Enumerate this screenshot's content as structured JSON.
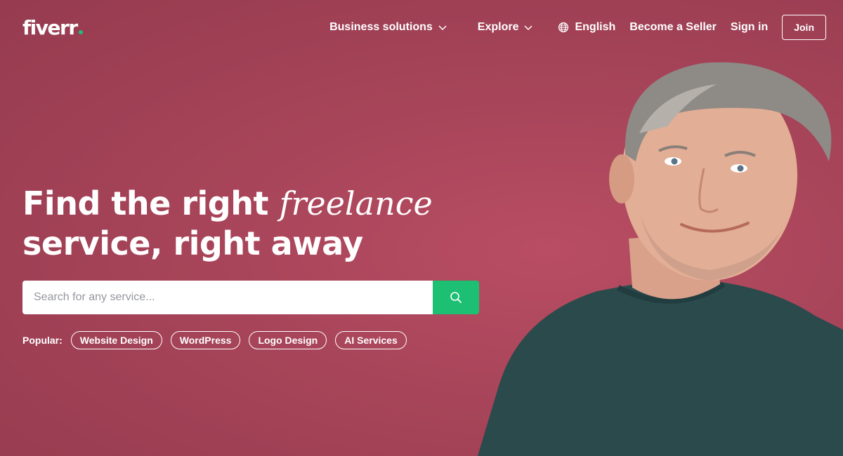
{
  "brand": {
    "name": "fiverr",
    "dot_color": "#1dbf73"
  },
  "nav": {
    "business_solutions": "Business solutions",
    "explore": "Explore",
    "language": "English",
    "become_seller": "Become a Seller",
    "sign_in": "Sign in",
    "join": "Join"
  },
  "hero": {
    "headline_part1": "Find the right",
    "headline_italic": "freelance",
    "headline_part2": "service, right away",
    "background_color": "#a74459"
  },
  "search": {
    "placeholder": "Search for any service...",
    "button_color": "#1dbf73",
    "button_icon": "search-icon"
  },
  "popular": {
    "label": "Popular:",
    "tags": [
      "Website Design",
      "WordPress",
      "Logo Design",
      "AI Services"
    ]
  },
  "icons": {
    "chevron": "chevron-down-icon",
    "globe": "globe-icon"
  }
}
